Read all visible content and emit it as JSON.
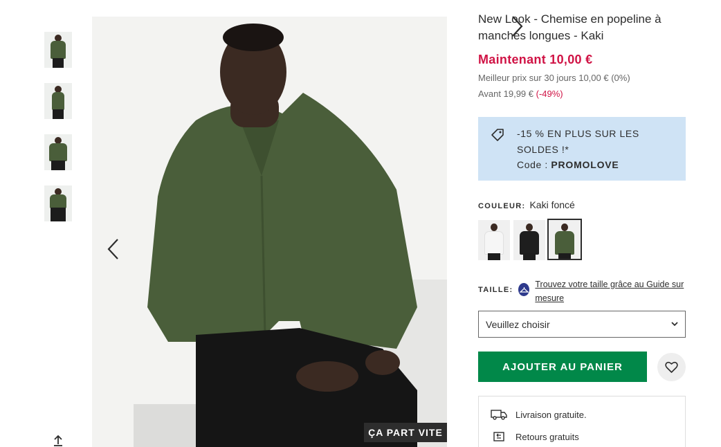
{
  "product": {
    "title": "New Look - Chemise en popeline à manches longues - Kaki",
    "price_now": "Maintenant 10,00 €",
    "best_price": "Meilleur prix sur 30 jours 10,00 € (0%)",
    "before_price": "Avant 19,99 €",
    "before_discount": "(-49%)"
  },
  "gallery": {
    "thumbnail_count": 4,
    "badge": "ÇA PART VITE"
  },
  "promo": {
    "line1": "-15 % EN PLUS SUR LES SOLDES !*",
    "code_label": "Code : ",
    "code": "PROMOLOVE"
  },
  "color": {
    "label": "COULEUR:",
    "value": "Kaki foncé",
    "swatches": [
      {
        "name": "white",
        "shirt_color": "#f4f4f4"
      },
      {
        "name": "black",
        "shirt_color": "#1e1e1e"
      },
      {
        "name": "khaki",
        "shirt_color": "#4a5e3a",
        "selected": true
      }
    ]
  },
  "size": {
    "label": "TAILLE:",
    "guide_link": "Trouvez votre taille grâce au Guide sur mesure",
    "select_placeholder": "Veuillez choisir"
  },
  "actions": {
    "add_to_cart": "AJOUTER AU PANIER"
  },
  "delivery": {
    "free_delivery": "Livraison gratuite.",
    "free_returns": "Retours gratuits"
  },
  "colors": {
    "sale_red": "#d01345",
    "add_green": "#018849",
    "promo_blue": "#cfe3f5",
    "shirt_khaki": "#4a5e3a"
  },
  "icons": [
    "chevron-left-icon",
    "chevron-right-icon",
    "share-icon",
    "tag-icon",
    "hanger-icon",
    "chevron-down-icon",
    "heart-icon",
    "truck-icon",
    "return-icon"
  ]
}
